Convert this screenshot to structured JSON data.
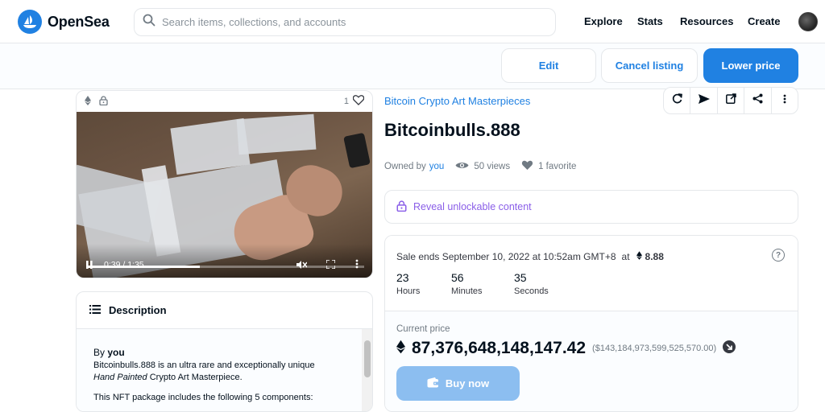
{
  "header": {
    "brand": "OpenSea",
    "search_placeholder": "Search items, collections, and accounts",
    "nav": [
      "Explore",
      "Stats",
      "Resources",
      "Create"
    ]
  },
  "actions": {
    "edit": "Edit",
    "cancel": "Cancel listing",
    "lower": "Lower price"
  },
  "media": {
    "likes": "1",
    "time": "0:39 / 1:35",
    "progress_fraction": 0.41
  },
  "description": {
    "title": "Description",
    "by": "By",
    "author": "you",
    "line1": "Bitcoinbulls.888 is an ultra rare and exceptionally unique",
    "line2_italic": "Hand Painted",
    "line2_rest": " Crypto Art Masterpiece.",
    "line3": "This NFT package includes the following 5 components:"
  },
  "item": {
    "collection": "Bitcoin Crypto Art Masterpieces",
    "title": "Bitcoinbulls.888",
    "owned_by": "Owned by",
    "owner": "you",
    "views": "50 views",
    "favorites": "1 favorite",
    "unlockable": "Reveal unlockable content"
  },
  "sale": {
    "ends": "Sale ends September 10, 2022 at 10:52am GMT+8",
    "at": "at",
    "price_eth": "8.88",
    "countdown": [
      {
        "num": "23",
        "label": "Hours"
      },
      {
        "num": "56",
        "label": "Minutes"
      },
      {
        "num": "35",
        "label": "Seconds"
      }
    ],
    "current_label": "Current price",
    "current_value": "87,376,648,148,147.42",
    "current_usd": "($143,184,973,599,525,570.00)",
    "buy": "Buy now"
  },
  "colors": {
    "brand_blue": "#2081e2",
    "purple": "#8a5ee8",
    "text": "#04111d",
    "muted": "#707a83"
  }
}
